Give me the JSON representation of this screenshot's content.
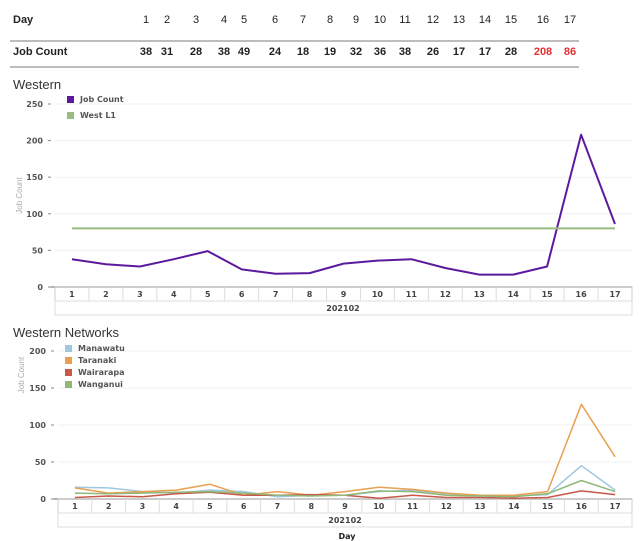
{
  "table": {
    "row1_label": "Day",
    "row2_label": "Job Count",
    "days": [
      "1",
      "2",
      "3",
      "4",
      "5",
      "6",
      "7",
      "8",
      "9",
      "10",
      "11",
      "12",
      "13",
      "14",
      "15",
      "16",
      "17"
    ],
    "counts": [
      "38",
      "31",
      "28",
      "38",
      "49",
      "24",
      "18",
      "19",
      "32",
      "36",
      "38",
      "26",
      "17",
      "17",
      "28",
      "208",
      "86"
    ],
    "highlight_color": "#e03030",
    "highlight_indices": [
      15,
      16
    ]
  },
  "chart_data": [
    {
      "type": "line",
      "title": "Western",
      "xlabel": "",
      "group_label": "202102",
      "ylabel": "Job Count",
      "x": [
        "1",
        "2",
        "3",
        "4",
        "5",
        "6",
        "7",
        "8",
        "9",
        "10",
        "11",
        "12",
        "13",
        "14",
        "15",
        "16",
        "17"
      ],
      "ylim": [
        0,
        250
      ],
      "yticks": [
        0,
        50,
        100,
        150,
        200,
        250
      ],
      "grid": true,
      "legend": "top-left",
      "series": [
        {
          "name": "Job Count",
          "color": "#5b1a9e",
          "values": [
            38,
            31,
            28,
            38,
            49,
            24,
            18,
            19,
            32,
            36,
            38,
            26,
            17,
            17,
            28,
            208,
            86
          ]
        },
        {
          "name": "West L1",
          "color": "#9bbb84",
          "values": [
            80,
            80,
            80,
            80,
            80,
            80,
            80,
            80,
            80,
            80,
            80,
            80,
            80,
            80,
            80,
            80,
            80
          ]
        }
      ]
    },
    {
      "type": "line",
      "title": "Western Networks",
      "xlabel": "Day",
      "group_label": "202102",
      "ylabel": "Job Count",
      "x": [
        "1",
        "2",
        "3",
        "4",
        "5",
        "6",
        "7",
        "8",
        "9",
        "10",
        "11",
        "12",
        "13",
        "14",
        "15",
        "16",
        "17"
      ],
      "ylim": [
        0,
        200
      ],
      "yticks": [
        0,
        50,
        100,
        150,
        200
      ],
      "grid": true,
      "legend": "top-left",
      "series": [
        {
          "name": "Manawatu",
          "color": "#9ec8e0",
          "values": [
            16,
            15,
            10,
            8,
            12,
            10,
            3,
            5,
            5,
            10,
            12,
            7,
            5,
            4,
            6,
            45,
            12
          ]
        },
        {
          "name": "Taranaki",
          "color": "#e8a050",
          "values": [
            15,
            8,
            10,
            12,
            20,
            5,
            10,
            5,
            10,
            16,
            13,
            8,
            5,
            5,
            10,
            128,
            57
          ]
        },
        {
          "name": "Wairarapa",
          "color": "#c8584a",
          "values": [
            2,
            4,
            3,
            7,
            9,
            5,
            5,
            6,
            5,
            1,
            5,
            2,
            2,
            1,
            2,
            11,
            6
          ]
        },
        {
          "name": "Wanganui",
          "color": "#8fb878",
          "values": [
            8,
            7,
            8,
            9,
            10,
            8,
            5,
            4,
            5,
            11,
            10,
            5,
            4,
            3,
            7,
            25,
            10
          ]
        }
      ]
    }
  ]
}
